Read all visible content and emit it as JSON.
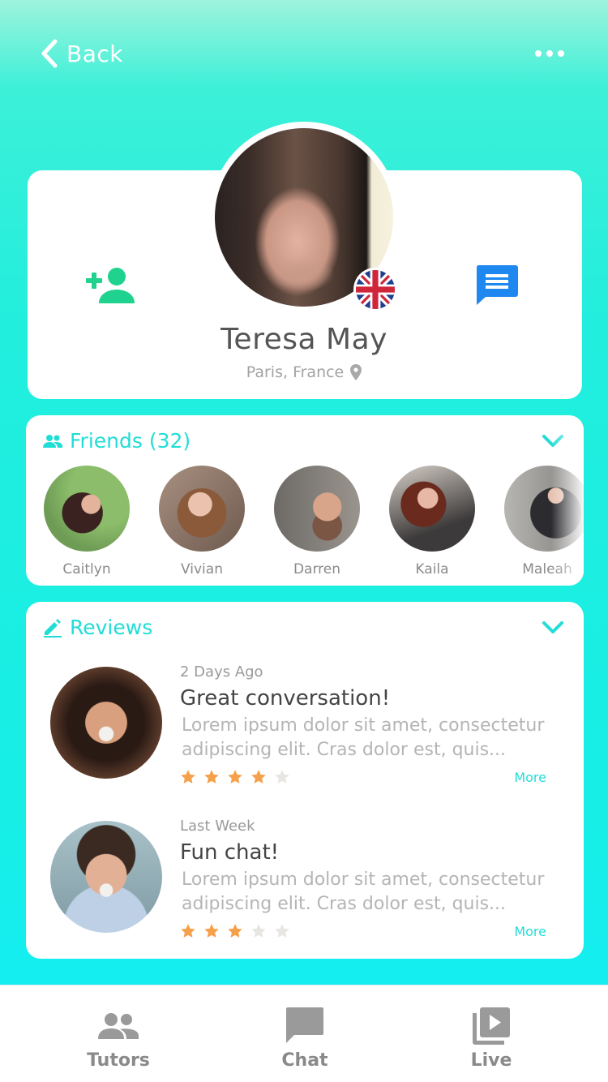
{
  "header": {
    "back_label": "Back",
    "more_icon": "more-horizontal-icon"
  },
  "profile": {
    "name": "Teresa May",
    "location": "Paris, France",
    "flag_icon": "uk-flag-icon",
    "add_friend_icon": "person-add-icon",
    "message_icon": "message-icon"
  },
  "friends": {
    "title": "Friends (32)",
    "items": [
      {
        "name": "Caitlyn"
      },
      {
        "name": "Vivian"
      },
      {
        "name": "Darren"
      },
      {
        "name": "Kaila"
      },
      {
        "name": "Maleah"
      }
    ]
  },
  "reviews": {
    "title": "Reviews",
    "items": [
      {
        "when": "2 Days Ago",
        "title": "Great conversation!",
        "text": "Lorem ipsum dolor sit amet, consectetur adipiscing elit. Cras dolor est, quis...",
        "rating": 4,
        "rating_max": 5,
        "more": "More"
      },
      {
        "when": "Last Week",
        "title": "Fun chat!",
        "text": "Lorem ipsum dolor sit amet, consectetur adipiscing elit. Cras dolor est, quis...",
        "rating": 3,
        "rating_max": 5,
        "more": "More"
      }
    ]
  },
  "tabbar": {
    "tabs": [
      {
        "label": "Tutors",
        "icon": "people-icon"
      },
      {
        "label": "Chat",
        "icon": "chat-icon"
      },
      {
        "label": "Live",
        "icon": "video-library-icon"
      }
    ]
  },
  "colors": {
    "accent": "#22ddd6",
    "add_friend": "#1fd38e",
    "message": "#1e88f0",
    "star_on": "#f5a04a",
    "star_off": "#e8e6e2"
  }
}
